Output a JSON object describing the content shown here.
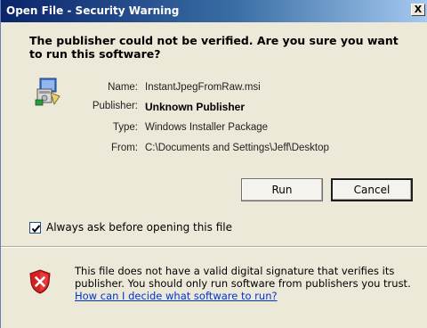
{
  "window": {
    "title": "Open File - Security Warning",
    "close_glyph": "X"
  },
  "question": "The publisher could not be verified.  Are you sure you want to run this software?",
  "file_info": {
    "name": {
      "label": "Name:",
      "value": "InstantJpegFromRaw.msi"
    },
    "publisher": {
      "label": "Publisher:",
      "value": "Unknown Publisher"
    },
    "type": {
      "label": "Type:",
      "value": "Windows Installer Package"
    },
    "from": {
      "label": "From:",
      "value": "C:\\Documents and Settings\\Jeff\\Desktop"
    }
  },
  "buttons": {
    "run": "Run",
    "cancel": "Cancel"
  },
  "checkbox": {
    "label": "Always ask before opening this file",
    "checked": true
  },
  "warning": {
    "text": "This file does not have a valid digital signature that verifies its publisher.  You should only run software from publishers you trust.",
    "link": "How can I decide what software to run?"
  },
  "icons": {
    "file": "installer-package-icon",
    "shield": "security-shield-icon",
    "check": "checkmark-icon"
  },
  "colors": {
    "title_bar_start": "#0a246a",
    "title_bar_end": "#a6caf0",
    "dialog_bg": "#ece9d8",
    "link": "#0033cc",
    "shield_red": "#d42020"
  }
}
